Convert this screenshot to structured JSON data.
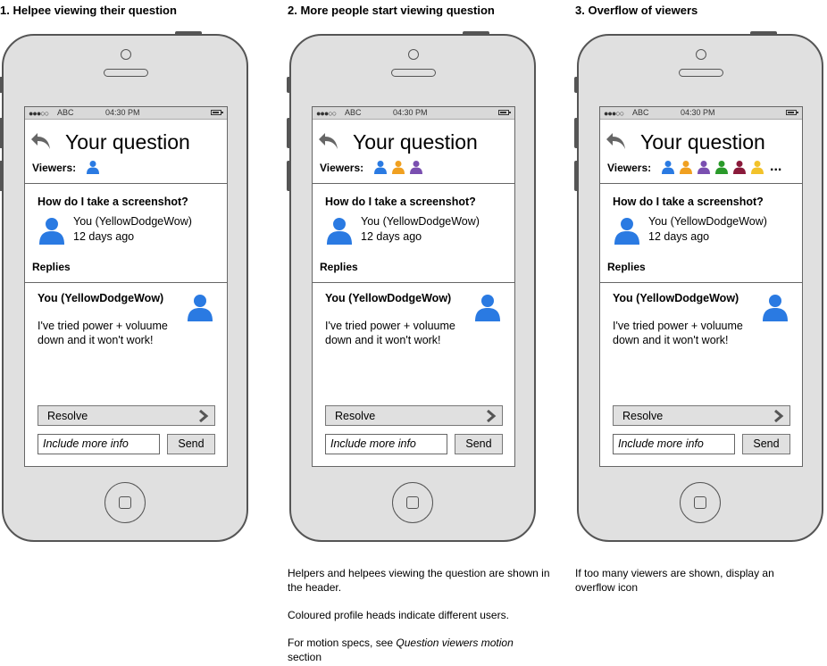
{
  "colors": {
    "viewer_blue": "#2a7ae2",
    "viewer_orange": "#f0a020",
    "viewer_purple": "#7a4fb0",
    "viewer_green": "#2a9a2a",
    "viewer_maroon": "#8a1a3a",
    "viewer_yellow": "#f2c22a",
    "phone_body": "#e0e0e0",
    "phone_outline": "#555555"
  },
  "panels": [
    {
      "title": "1. Helpee viewing their question",
      "viewers": [
        "viewer_blue"
      ],
      "overflow": ""
    },
    {
      "title": "2. More people start viewing question",
      "viewers": [
        "viewer_blue",
        "viewer_orange",
        "viewer_purple"
      ],
      "overflow": ""
    },
    {
      "title": "3. Overflow of viewers",
      "viewers": [
        "viewer_blue",
        "viewer_orange",
        "viewer_purple",
        "viewer_green",
        "viewer_maroon",
        "viewer_yellow"
      ],
      "overflow": "..."
    }
  ],
  "screen": {
    "status_signal": "●●●○○",
    "status_carrier": "ABC",
    "status_time": "04:30 PM",
    "title": "Your question",
    "viewers_label": "Viewers:",
    "question": "How do I take a screenshot?",
    "question_author": "You (YellowDodgeWow)",
    "question_age": "12 days ago",
    "replies_label": "Replies",
    "reply_author": "You (YellowDodgeWow)",
    "reply_text": "I've tried power + voluume down and it won't work!",
    "resolve_label": "Resolve",
    "input_placeholder": "Include more info",
    "send_label": "Send"
  },
  "notes": {
    "panel2": {
      "p1": "Helpers and helpees viewing the question are shown in the header.",
      "p2": "Coloured profile heads indicate different users.",
      "p3_prefix": "For motion specs, see ",
      "p3_italic": "Question viewers motion",
      "p3_suffix": " section"
    },
    "panel3": {
      "p1": "If too many viewers are shown, display an overflow icon"
    }
  }
}
